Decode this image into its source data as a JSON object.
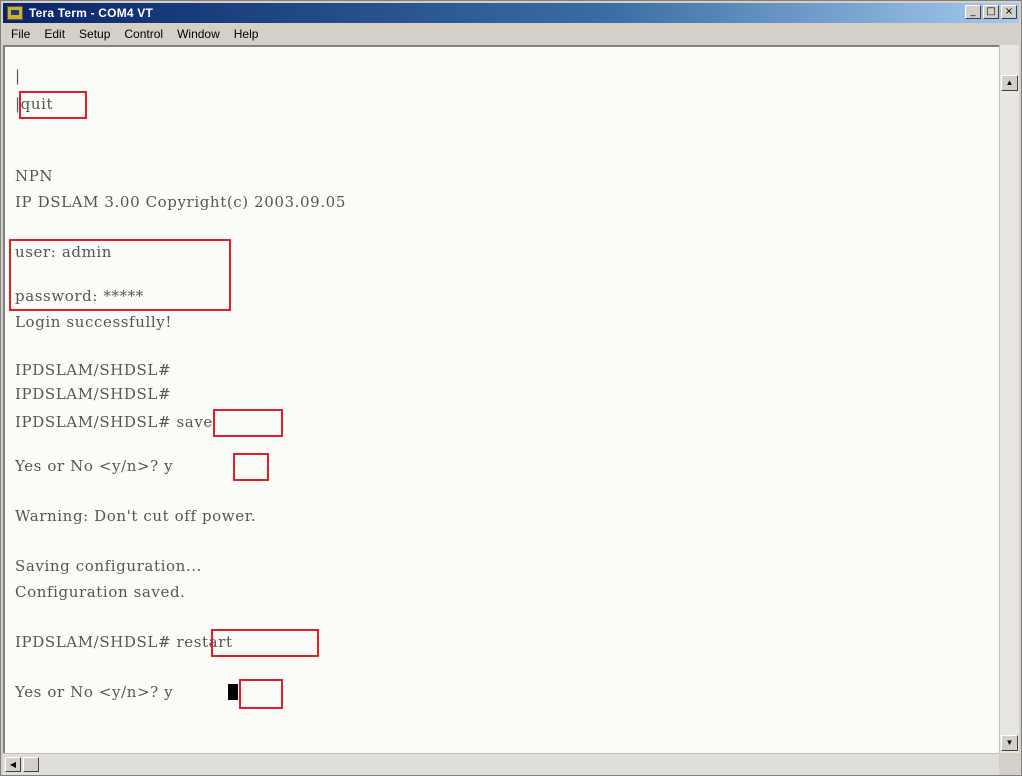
{
  "window": {
    "title": "Tera Term - COM4 VT",
    "controls": [
      "_",
      "□",
      "×"
    ]
  },
  "menu": [
    "File",
    "Edit",
    "Setup",
    "Control",
    "Window",
    "Help"
  ],
  "terminal": {
    "lines": [
      "|",
      "|quit",
      "",
      "NPN",
      "IP DSLAM 3.00 Copyright(c) 2003.09.05",
      "",
      "user: admin",
      "",
      "password: *****",
      "Login successfully!",
      "",
      "IPDSLAM/SHDSL#",
      "IPDSLAM/SHDSL#",
      "IPDSLAM/SHDSL# save",
      "",
      "Yes or No <y/n>? y",
      "",
      "Warning: Don't cut off power.",
      "",
      "Saving configuration...",
      "Configuration saved.",
      "",
      "IPDSLAM/SHDSL# restart",
      "",
      "Yes or No <y/n>? y"
    ]
  },
  "icons": {
    "app": "tera-term-icon",
    "scroll_up": "arrow-up-icon",
    "scroll_down": "arrow-down-icon",
    "scroll_left": "arrow-left-icon"
  },
  "colors": {
    "highlight_box": "#e01e2a",
    "terminal_bg": "#fbfbf8",
    "title_gradient_start": "#0a246a"
  }
}
